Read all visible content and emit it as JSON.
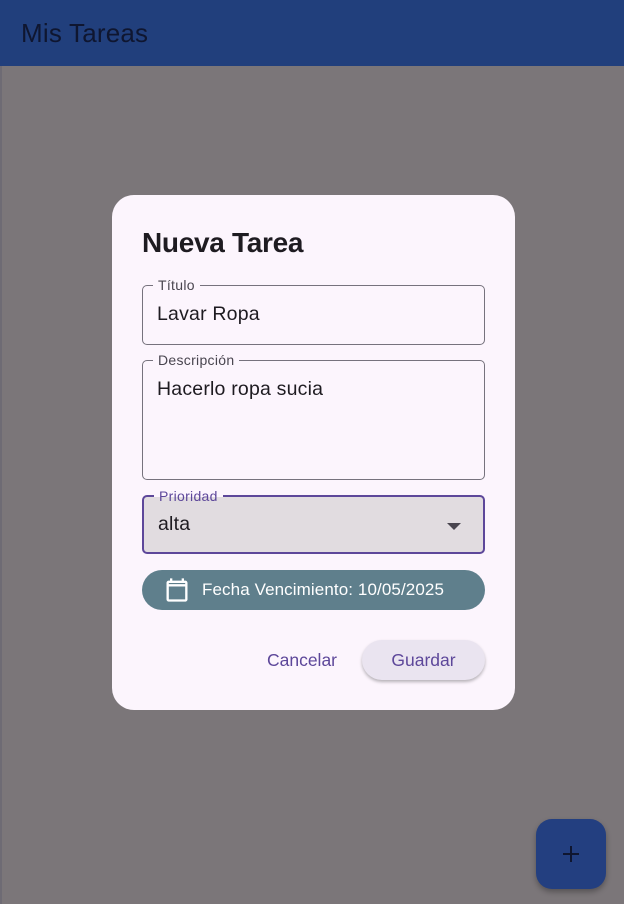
{
  "appbar": {
    "title": "Mis Tareas"
  },
  "dialog": {
    "title": "Nueva Tarea",
    "title_field": {
      "label": "Título",
      "value": "Lavar Ropa"
    },
    "description_field": {
      "label": "Descripción",
      "value": "Hacerlo ropa sucia"
    },
    "priority_field": {
      "label": "Prioridad",
      "value": "alta",
      "icon": "dropdown-arrow-icon"
    },
    "due_date_button": {
      "icon": "calendar-icon",
      "label": "Fecha Vencimiento: 10/05/2025"
    },
    "actions": {
      "cancel_label": "Cancelar",
      "save_label": "Guardar"
    }
  },
  "fab": {
    "icon": "plus-icon"
  },
  "colors": {
    "appbar_bg": "#213f7c",
    "scrim": "#7b7679",
    "dialog_bg": "#fcf5fd",
    "accent": "#5d479a",
    "date_chip_bg": "#5f7f8c",
    "fab_bg": "#233f80"
  }
}
